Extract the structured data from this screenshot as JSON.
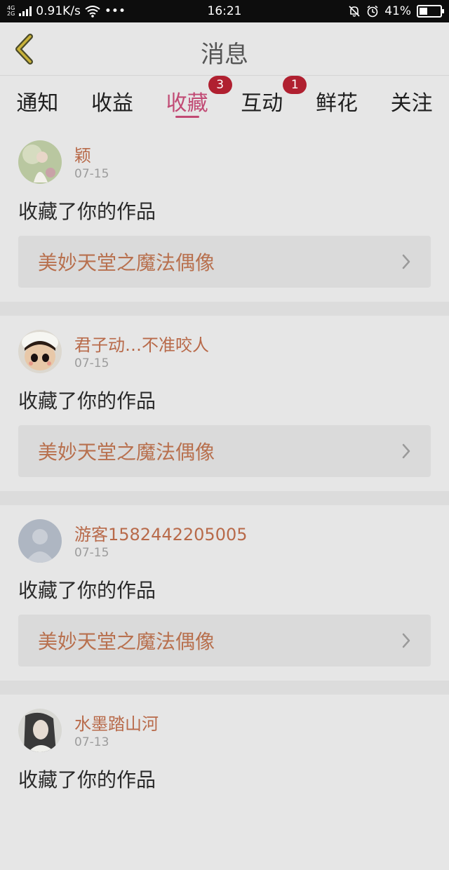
{
  "status_bar": {
    "net_top": "4G",
    "net_bottom": "2G",
    "speed": "0.91K/s",
    "dots": "•••",
    "time": "16:21",
    "battery_text": "41%",
    "battery_level": 0.41
  },
  "header": {
    "title": "消息",
    "back_icon": "chevron-left-icon"
  },
  "tabs": [
    {
      "label": "通知",
      "badge": ""
    },
    {
      "label": "收益",
      "badge": ""
    },
    {
      "label": "收藏",
      "badge": "3",
      "active": true
    },
    {
      "label": "互动",
      "badge": "1"
    },
    {
      "label": "鲜花",
      "badge": ""
    },
    {
      "label": "关注",
      "badge": ""
    }
  ],
  "items": [
    {
      "name": "颖",
      "date": "07-15",
      "action": "收藏了你的作品",
      "work": "美妙天堂之魔法偶像",
      "avatar": "avatar-girl-icon"
    },
    {
      "name": "君子动…不准咬人",
      "date": "07-15",
      "action": "收藏了你的作品",
      "work": "美妙天堂之魔法偶像",
      "avatar": "avatar-doll-icon"
    },
    {
      "name": "游客1582442205005",
      "date": "07-15",
      "action": "收藏了你的作品",
      "work": "美妙天堂之魔法偶像",
      "avatar": "avatar-default-icon"
    },
    {
      "name": "水墨踏山河",
      "date": "07-13",
      "action": "收藏了你的作品",
      "work": "",
      "avatar": "avatar-woman-icon"
    }
  ],
  "colors": {
    "accent": "#c14a74",
    "badge": "#b02030",
    "name": "#b86a4a",
    "work": "#b8704e"
  }
}
